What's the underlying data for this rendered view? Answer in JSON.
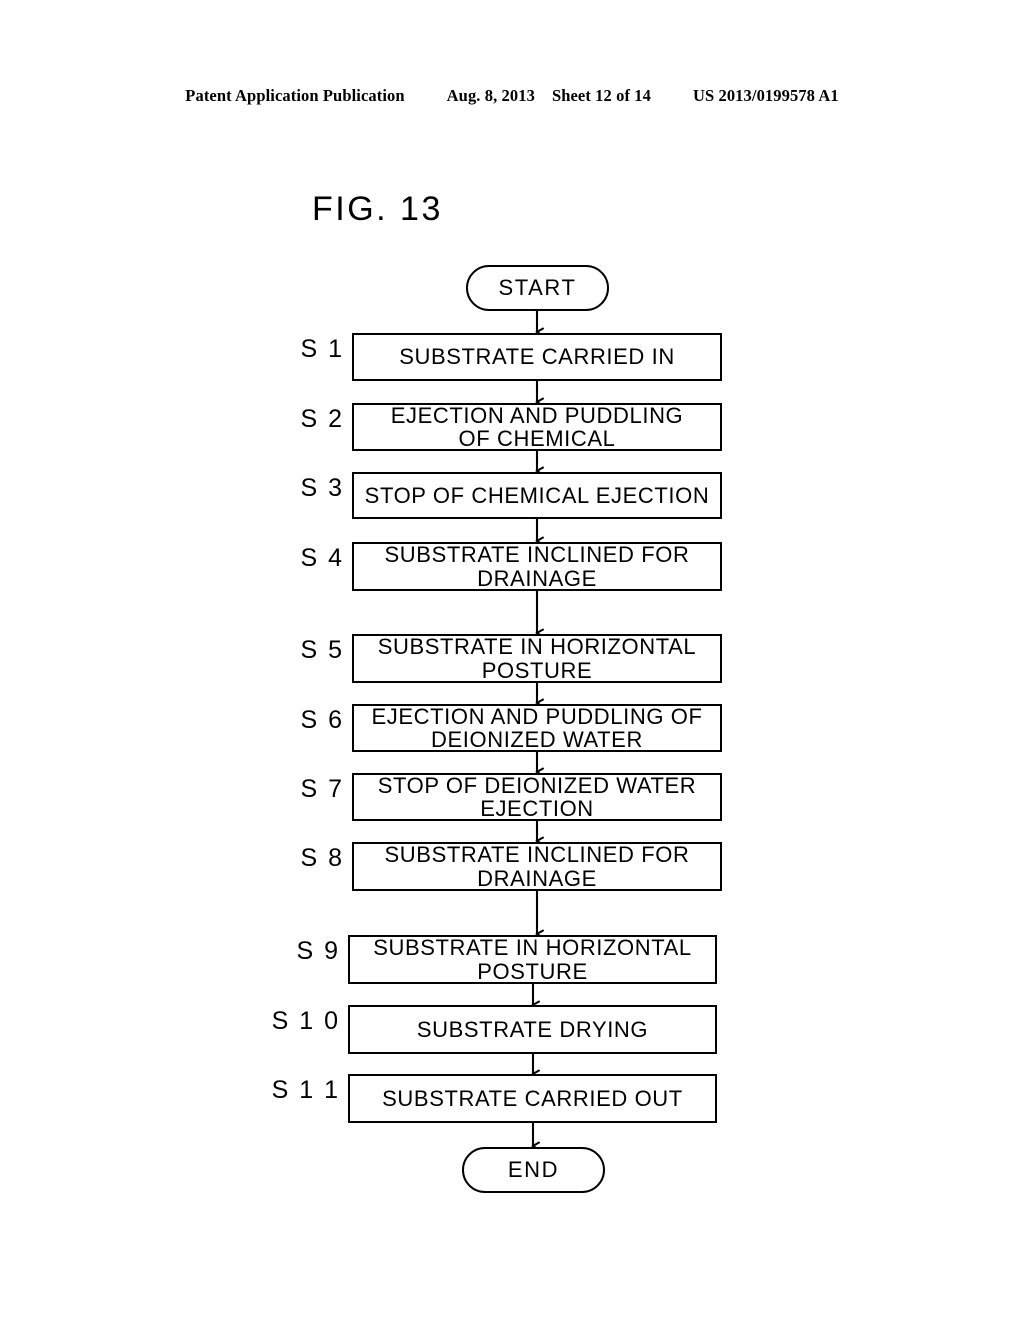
{
  "header": {
    "publication": "Patent Application Publication",
    "date": "Aug. 8, 2013",
    "sheet": "Sheet 12 of 14",
    "patent_number": "US 2013/0199578 A1"
  },
  "figure": {
    "label": "FIG. 13"
  },
  "flowchart": {
    "start_label": "START",
    "end_label": "END",
    "steps": [
      {
        "id": "S 1",
        "text": "SUBSTRATE CARRIED IN"
      },
      {
        "id": "S 2",
        "text": "EJECTION AND PUDDLING\nOF CHEMICAL"
      },
      {
        "id": "S 3",
        "text": "STOP OF CHEMICAL EJECTION"
      },
      {
        "id": "S 4",
        "text": "SUBSTRATE INCLINED FOR\nDRAINAGE"
      },
      {
        "id": "S 5",
        "text": "SUBSTRATE IN HORIZONTAL\nPOSTURE"
      },
      {
        "id": "S 6",
        "text": "EJECTION AND PUDDLING OF\nDEIONIZED WATER"
      },
      {
        "id": "S 7",
        "text": "STOP OF DEIONIZED WATER\nEJECTION"
      },
      {
        "id": "S 8",
        "text": "SUBSTRATE INCLINED FOR\nDRAINAGE"
      },
      {
        "id": "S 9",
        "text": "SUBSTRATE IN HORIZONTAL\nPOSTURE"
      },
      {
        "id": "S 1 0",
        "text": "SUBSTRATE DRYING"
      },
      {
        "id": "S 1 1",
        "text": "SUBSTRATE CARRIED OUT"
      }
    ]
  },
  "colors": {
    "ink": "#000000",
    "paper": "#ffffff"
  }
}
